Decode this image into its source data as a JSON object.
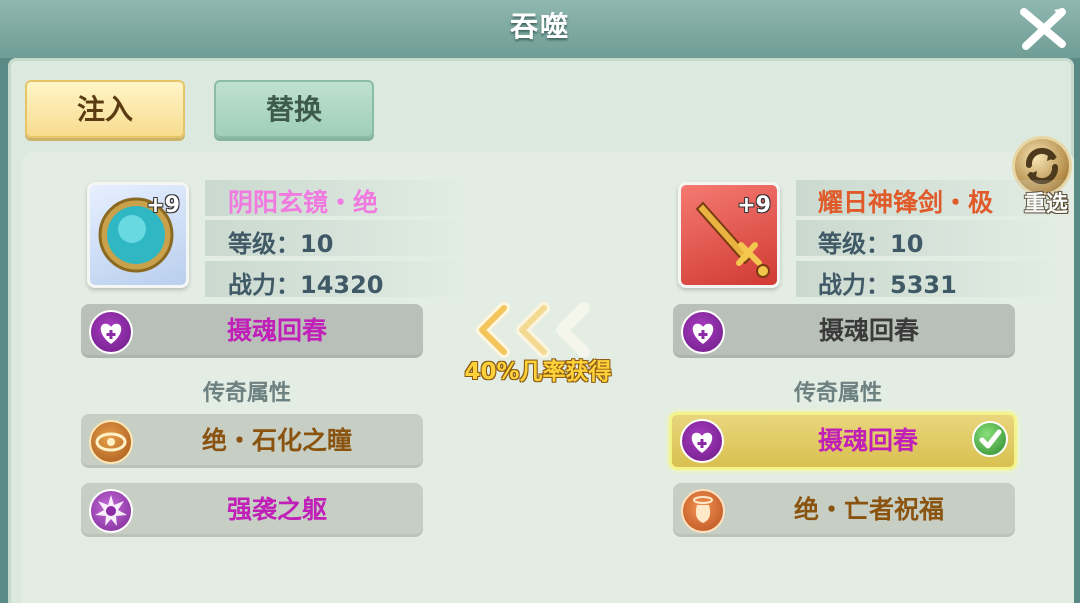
{
  "window": {
    "title": "吞噬"
  },
  "tabs": {
    "inject": "注入",
    "replace": "替换"
  },
  "reselect": {
    "label": "重选"
  },
  "left_item": {
    "name": "阴阳玄镜・绝",
    "enhance": "+9",
    "level_label": "等级：10",
    "power_label": "战力：14320",
    "name_color": "#f07ae0"
  },
  "right_item": {
    "name": "耀日神锋剑・极",
    "enhance": "+9",
    "level_label": "等级：10",
    "power_label": "战力：5331",
    "name_color": "#e05a2a"
  },
  "transfer": {
    "chance_text": "40%几率获得"
  },
  "left_attrs": {
    "main_skill": "摄魂回春",
    "legend_title": "传奇属性",
    "legend_1": "绝・石化之瞳",
    "legend_2": "强袭之躯"
  },
  "right_attrs": {
    "main_skill": "摄魂回春",
    "legend_title": "传奇属性",
    "legend_1": "摄魂回春",
    "legend_2": "绝・亡者祝福"
  },
  "colors": {
    "purple_text": "#c020b8",
    "gold_text": "#8a5410",
    "dark_text": "#3a3a3a"
  }
}
